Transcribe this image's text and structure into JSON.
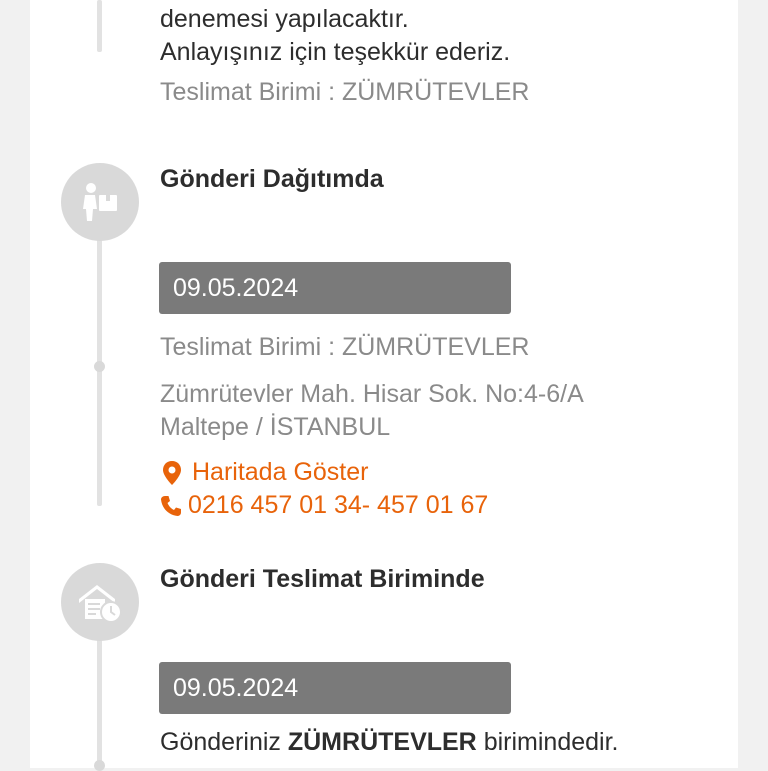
{
  "top_event": {
    "message_line1": "denemesi yapılacaktır.",
    "message_line2": "Anlayışınız için teşekkür ederiz.",
    "unit": "Teslimat Birimi : ZÜMRÜTEVLER"
  },
  "events": [
    {
      "title": "Gönderi Dağıtımda",
      "icon": "courier-delivery-icon",
      "date": "09.05.2024",
      "unit": "Teslimat Birimi : ZÜMRÜTEVLER",
      "address_line1": "Zümrütevler Mah. Hisar Sok. No:4-6/A",
      "address_line2": "Maltepe / İSTANBUL",
      "map_link": "Haritada Göster",
      "phone": "0216 457 01 34- 457 01 67"
    },
    {
      "title": "Gönderi Teslimat Biriminde",
      "icon": "branch-clock-icon",
      "date": "09.05.2024",
      "message_prefix": "Gönderiniz ",
      "message_bold": "ZÜMRÜTEVLER",
      "message_suffix": " birimindedir."
    }
  ],
  "colors": {
    "accent": "#e8630a",
    "badge": "#7a7a7a",
    "muted_text": "#8a8a8a",
    "timeline": "#d9d9d9"
  }
}
